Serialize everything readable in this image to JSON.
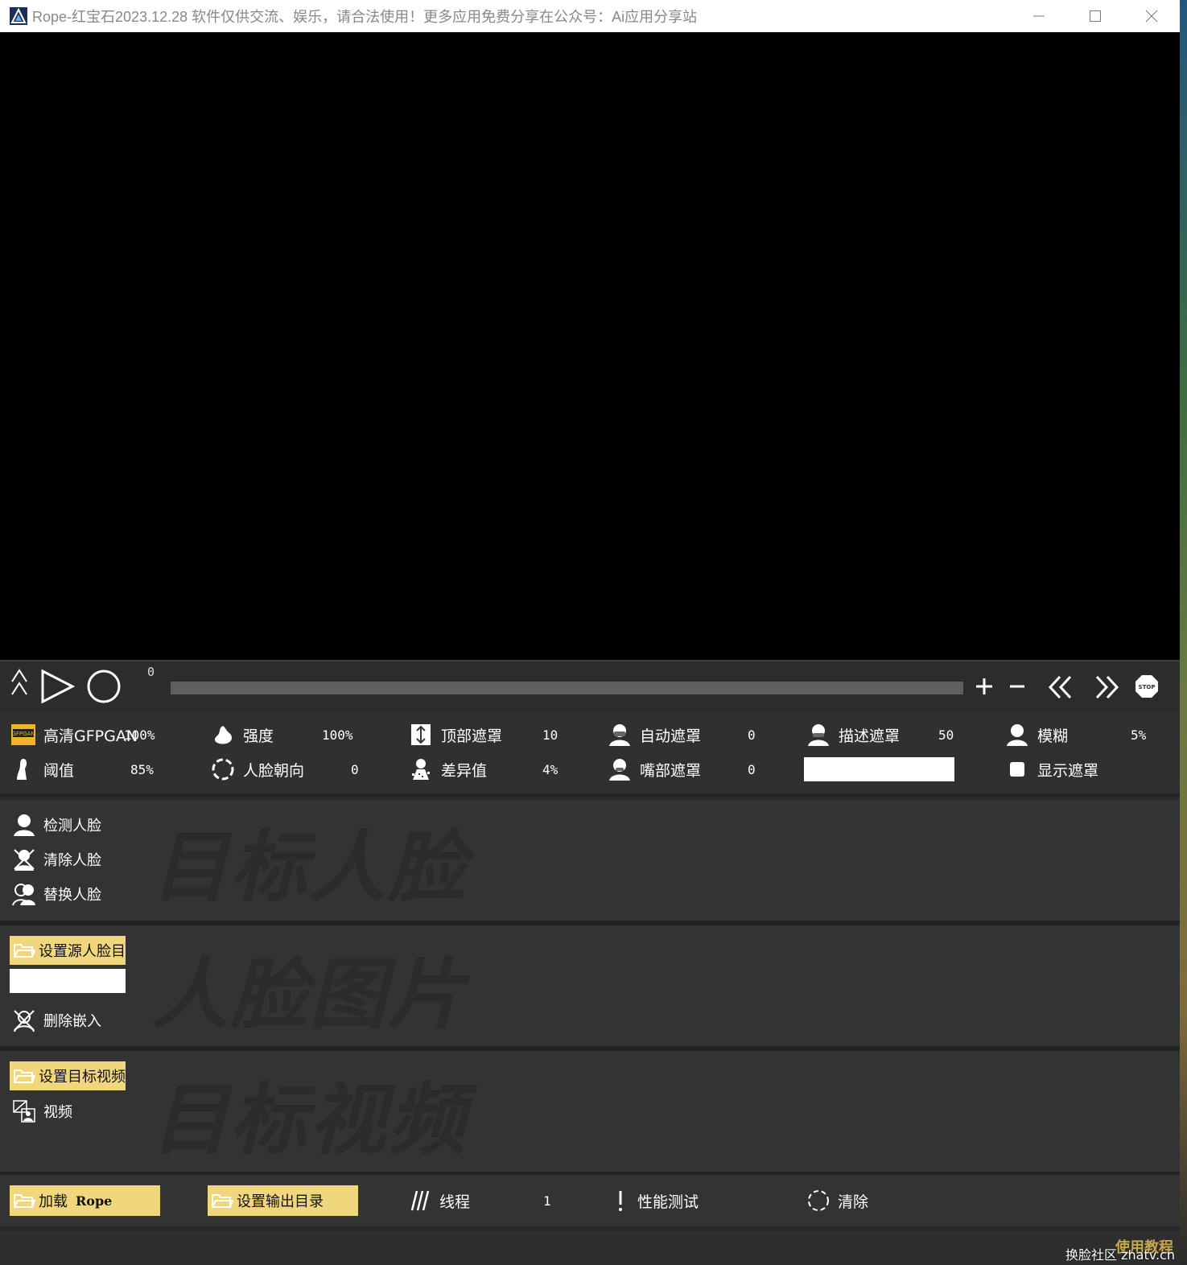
{
  "window": {
    "title": "Rope-红宝石2023.12.28 软件仅供交流、娱乐，请合法使用！更多应用免费分享在公众号：Ai应用分享站"
  },
  "playbar": {
    "frame": "0",
    "slider_position": 0
  },
  "params": [
    {
      "id": "gfpgan",
      "label": "高清GFPGAN",
      "value": "100%"
    },
    {
      "id": "strength",
      "label": "强度",
      "value": "100%"
    },
    {
      "id": "top-mask",
      "label": "顶部遮罩",
      "value": "10"
    },
    {
      "id": "auto-mask",
      "label": "自动遮罩",
      "value": "0"
    },
    {
      "id": "desc-mask",
      "label": "描述遮罩",
      "value": "50"
    },
    {
      "id": "blur",
      "label": "模糊",
      "value": "5%"
    },
    {
      "id": "threshold",
      "label": "阈值",
      "value": "85%"
    },
    {
      "id": "face-orient",
      "label": "人脸朝向",
      "value": "0"
    },
    {
      "id": "diff",
      "label": "差异值",
      "value": "4%"
    },
    {
      "id": "mouth-mask",
      "label": "嘴部遮罩",
      "value": "0"
    },
    {
      "id": "show-mask",
      "label": "显示遮罩",
      "value": ""
    }
  ],
  "target_faces": {
    "watermark": "目标人脸",
    "items": [
      "检测人脸",
      "清除人脸",
      "替换人脸"
    ]
  },
  "source_faces": {
    "watermark": "人脸图片",
    "set_dir_button": "设置源人脸目录",
    "delete_embed": "删除嵌入"
  },
  "target_videos": {
    "watermark": "目标视频",
    "set_video_button": "设置目标视频",
    "video_item": "视频"
  },
  "bottom": {
    "load_rope": "加载",
    "load_rope_brand": "Rope",
    "set_output": "设置输出目录",
    "threads_label": "线程",
    "threads_value": "1",
    "perf_label": "性能测试",
    "clear_label": "清除"
  },
  "status": {
    "tutorial": "使用教程",
    "site": "换脸社区 zhatv.cn"
  },
  "colors": {
    "accent_yellow": "#f0d77e",
    "panel": "#333333",
    "video_bg": "#000000"
  }
}
